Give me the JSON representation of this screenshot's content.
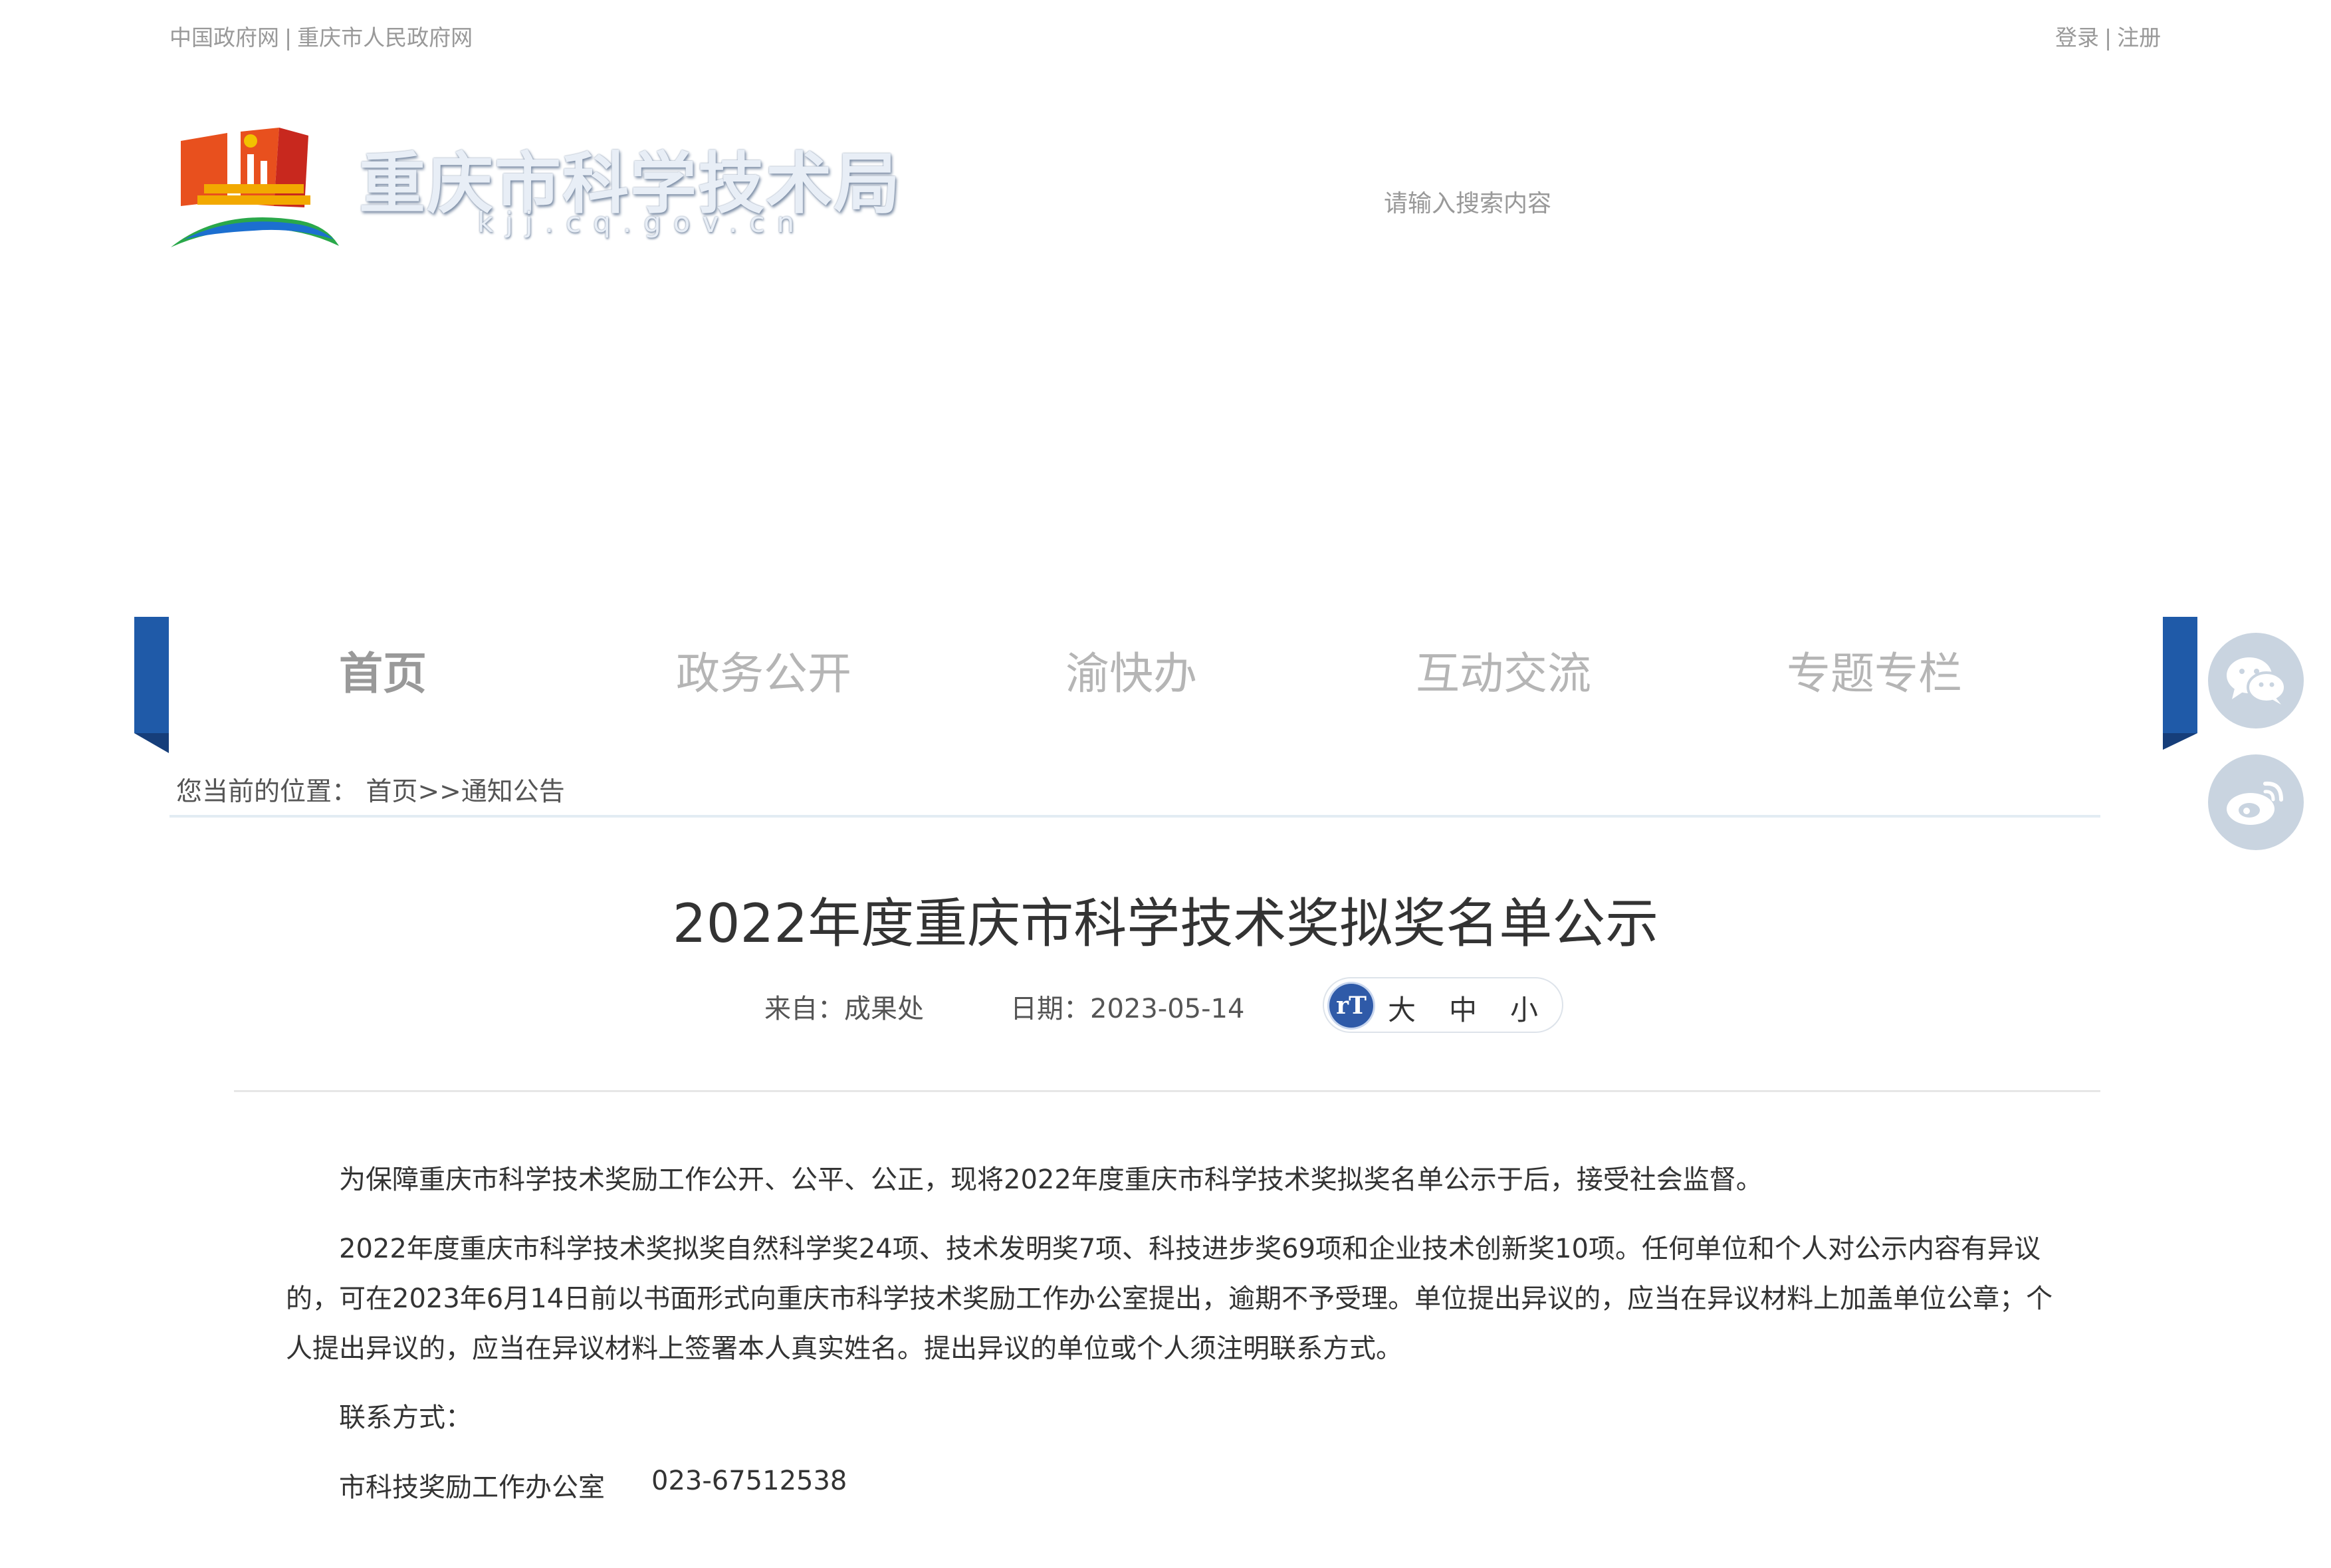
{
  "topbar": {
    "left_links": [
      "中国政府网",
      "重庆市人民政府网"
    ],
    "right_links": [
      "登录",
      "注册"
    ],
    "separator": "|"
  },
  "header": {
    "site_title": "重庆市科学技术局",
    "site_domain": "kjj.cq.gov.cn",
    "search_placeholder": "请输入搜索内容"
  },
  "nav": {
    "items": [
      "首页",
      "政务公开",
      "渝快办",
      "互动交流",
      "专题专栏"
    ],
    "active": "首页"
  },
  "social": [
    "wechat-icon",
    "weibo-icon"
  ],
  "breadcrumb": {
    "prefix": "您当前的位置：",
    "home": "首页",
    "arrow": ">>",
    "current": "通知公告"
  },
  "article": {
    "title": "2022年度重庆市科学技术奖拟奖名单公示",
    "source_label": "来自：成果处",
    "date_label": "日期：2023-05-14",
    "font_icon": "rT",
    "font_sizes": [
      "大",
      "中",
      "小"
    ],
    "p1": "为保障重庆市科学技术奖励工作公开、公平、公正，现将2022年度重庆市科学技术奖拟奖名单公示于后，接受社会监督。",
    "p2_line1": "2022年度重庆市科学技术奖拟奖自然科学奖24项、技术发明奖7项、科技进步奖69项和企业技术创新奖10项。任何单位和个人对公示内容有异议",
    "p2_line2": "的，可在2023年6月14日前以书面形式向重庆市科学技术奖励工作办公室提出，逾期不予受理。单位提出异议的，应当在异议材料上加盖单位公章；个",
    "p2_line3": "人提出异议的，应当在异议材料上签署本人真实姓名。提出异议的单位或个人须注明联系方式。",
    "contact_label": "联系方式：",
    "contact_office": "市科技奖励工作办公室",
    "contact_phone": "023-67512538"
  },
  "colors": {
    "nav_ribbon": "#1f5aa8",
    "font_icon_bg": "#2f5aa8",
    "social_bg": "#c9d4e0"
  }
}
